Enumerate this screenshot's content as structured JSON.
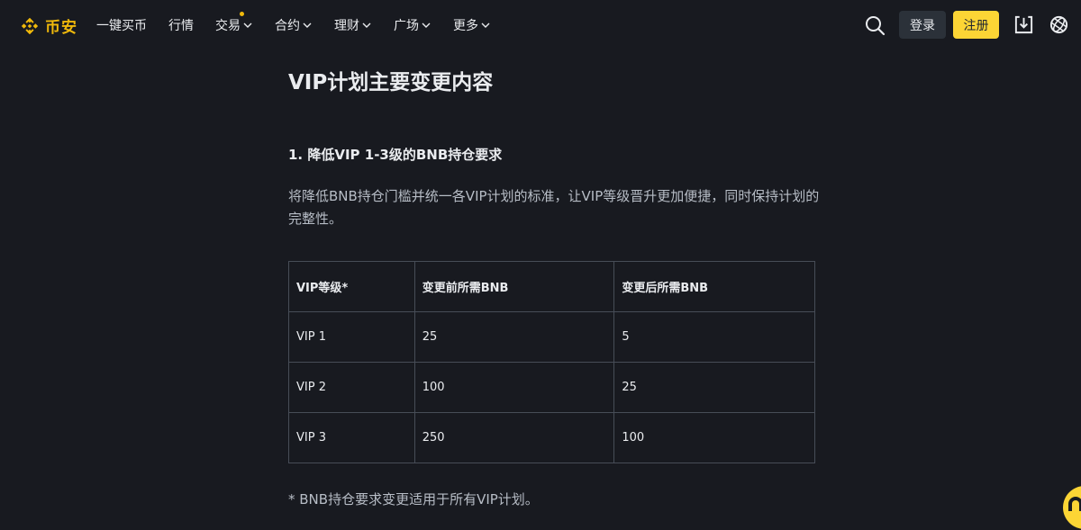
{
  "header": {
    "logo_text": "币安",
    "brand_color": "#f0b90b",
    "nav": [
      {
        "label": "一键买币",
        "has_dropdown": false,
        "has_dot": false
      },
      {
        "label": "行情",
        "has_dropdown": false,
        "has_dot": false
      },
      {
        "label": "交易",
        "has_dropdown": true,
        "has_dot": true
      },
      {
        "label": "合约",
        "has_dropdown": true,
        "has_dot": false
      },
      {
        "label": "理财",
        "has_dropdown": true,
        "has_dot": false
      },
      {
        "label": "广场",
        "has_dropdown": true,
        "has_dot": false
      },
      {
        "label": "更多",
        "has_dropdown": true,
        "has_dot": false
      }
    ],
    "login_label": "登录",
    "register_label": "注册",
    "icons": {
      "search": "search-icon",
      "download": "download-icon",
      "globe": "globe-icon"
    }
  },
  "article": {
    "title": "VIP计划主要变更内容",
    "section_heading": "1. 降低VIP 1-3级的BNB持仓要求",
    "description": "将降低BNB持仓门槛并统一各VIP计划的标准，让VIP等级晋升更加便捷，同时保持计划的完整性。",
    "table": {
      "headers": [
        "VIP等级*",
        "变更前所需BNB",
        "变更后所需BNB"
      ],
      "rows": [
        [
          "VIP 1",
          "25",
          "5"
        ],
        [
          "VIP 2",
          "100",
          "25"
        ],
        [
          "VIP 3",
          "250",
          "100"
        ]
      ]
    },
    "footnote": "* BNB持仓要求变更适用于所有VIP计划。"
  }
}
